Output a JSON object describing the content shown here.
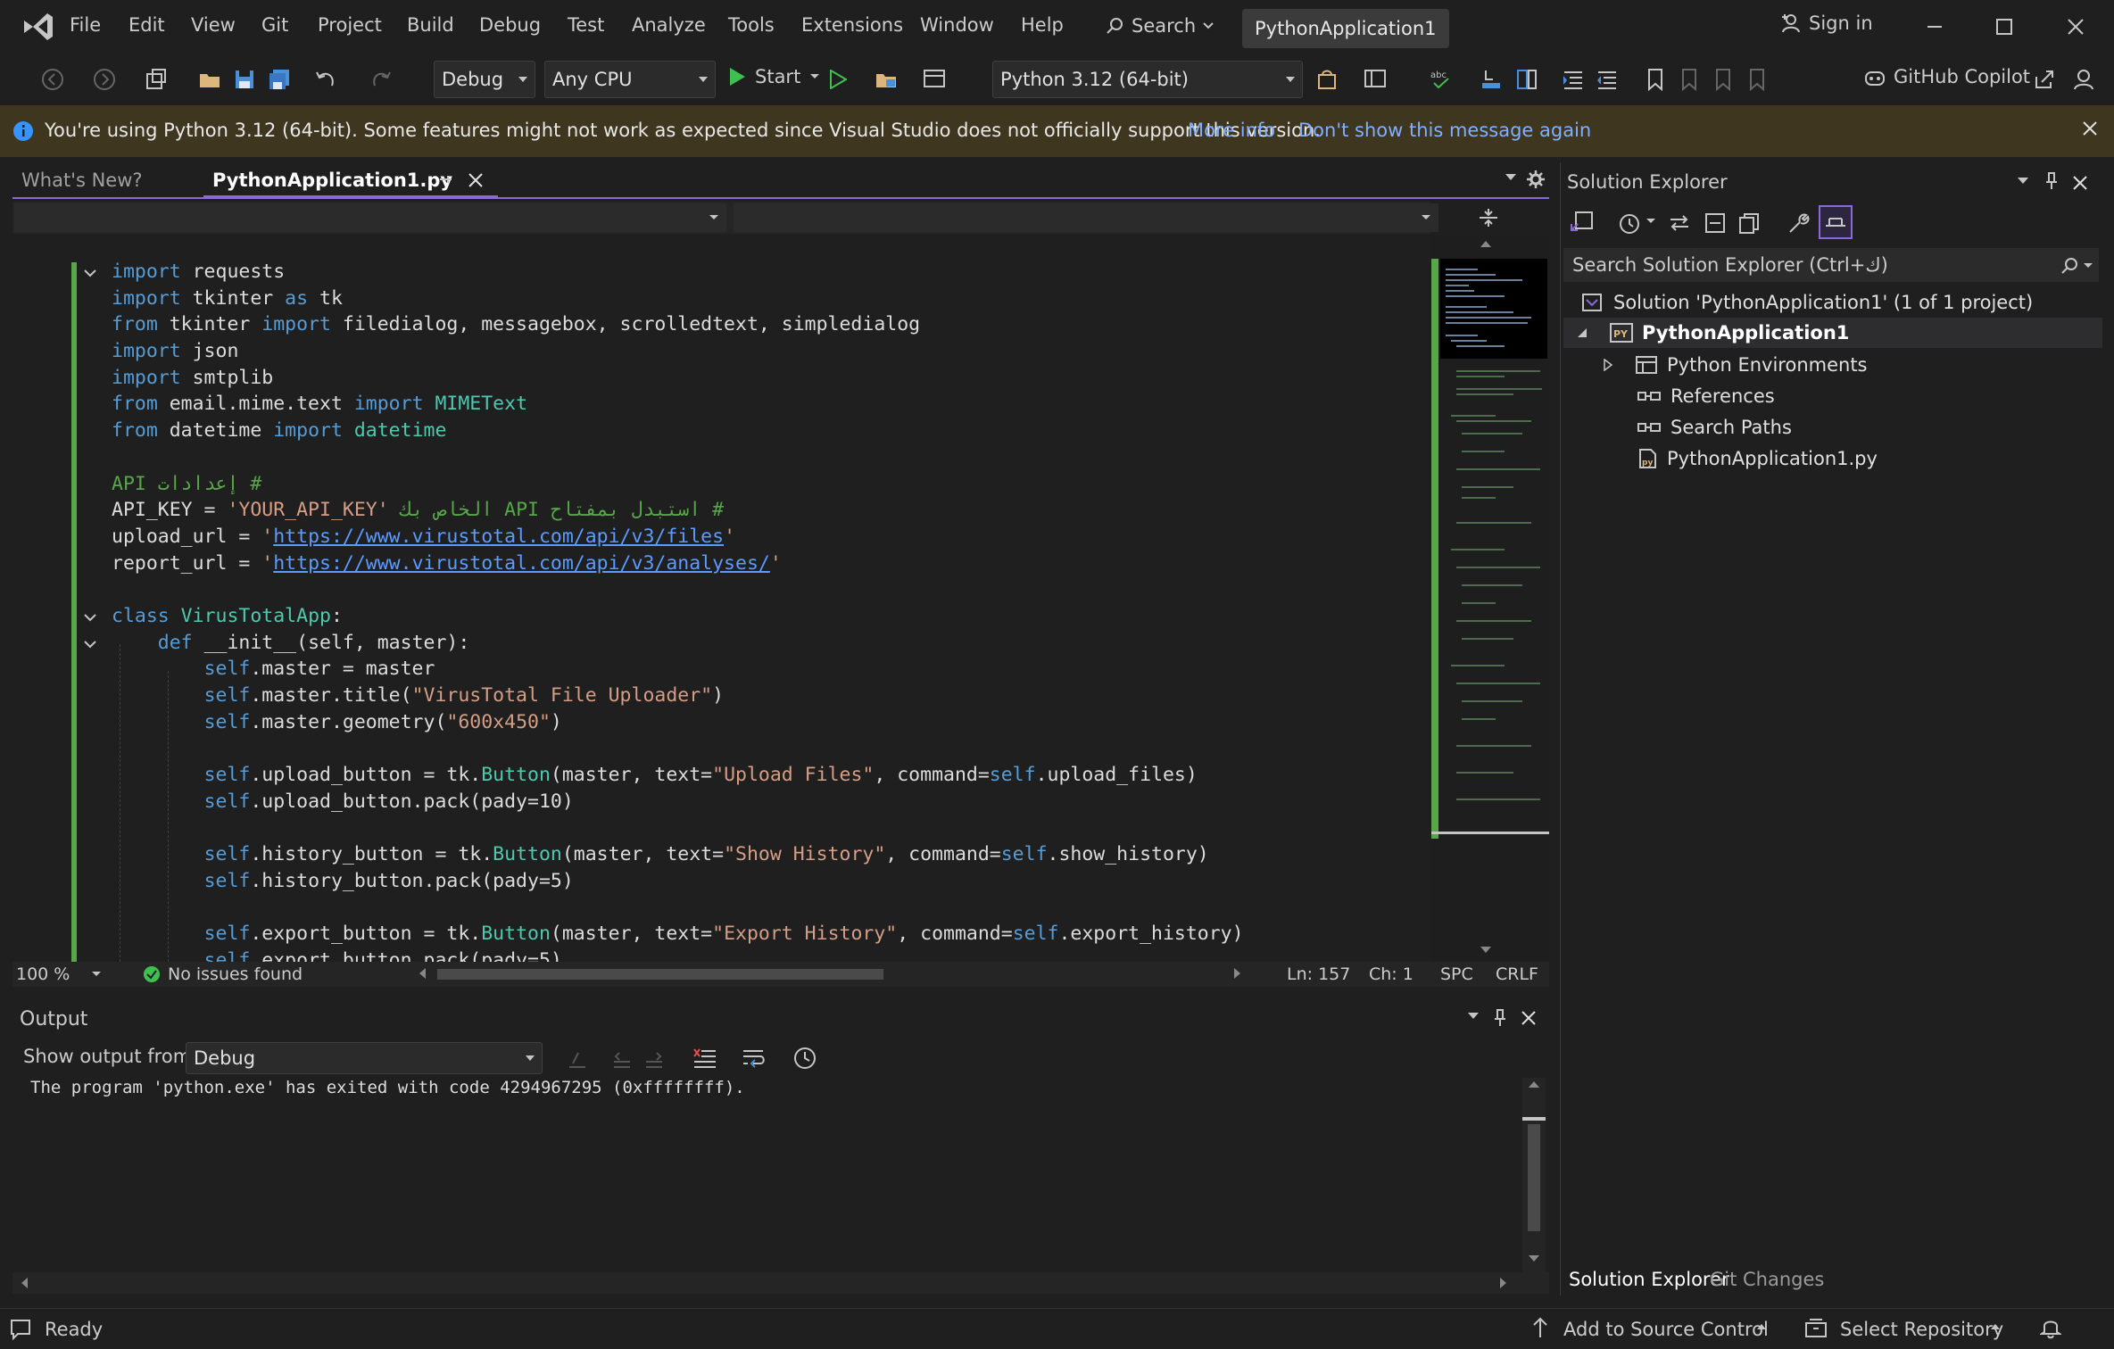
{
  "titlebar": {
    "menu": [
      "File",
      "Edit",
      "View",
      "Git",
      "Project",
      "Build",
      "Debug",
      "Test",
      "Analyze",
      "Tools",
      "Extensions",
      "Window",
      "Help"
    ],
    "search_label": "Search",
    "solution_name": "PythonApplication1",
    "signin_label": "Sign in"
  },
  "toolbar": {
    "configuration": "Debug",
    "platform": "Any CPU",
    "start_label": "Start",
    "environment": "Python 3.12 (64-bit)",
    "copilot_label": "GitHub Copilot"
  },
  "infobar": {
    "message": "You're using Python 3.12 (64-bit). Some features might not work as expected since Visual Studio does not officially support this version.",
    "more_info": "More info",
    "dont_show": "Don't show this message again"
  },
  "editor": {
    "tabs": [
      {
        "label": "What's New?"
      },
      {
        "label": "PythonApplication1.py"
      }
    ],
    "zoom": "100 %",
    "issues": "No issues found",
    "line": "Ln: 157",
    "column": "Ch: 1",
    "whitespace": "SPC",
    "line_ending": "CRLF"
  },
  "output": {
    "title": "Output",
    "show_from_label": "Show output from:",
    "source": "Debug",
    "text": "The program 'python.exe' has exited with code 4294967295 (0xffffffff)."
  },
  "solution_explorer": {
    "title": "Solution Explorer",
    "search_placeholder": "Search Solution Explorer (Ctrl+ك)",
    "solution": "Solution 'PythonApplication1' (1 of 1 project)",
    "project": "PythonApplication1",
    "items": [
      "Python Environments",
      "References",
      "Search Paths",
      "PythonApplication1.py"
    ],
    "bottom_tabs": [
      "Solution Explorer",
      "Git Changes"
    ]
  },
  "statusbar": {
    "ready": "Ready",
    "add_source_control": "Add to Source Control",
    "select_repository": "Select Repository"
  },
  "colors": {
    "accent": "#8a6ad8",
    "infobar_bg": "#3f361f",
    "keyword": "#569cd6",
    "string": "#d69d85",
    "comment": "#57a64a"
  }
}
